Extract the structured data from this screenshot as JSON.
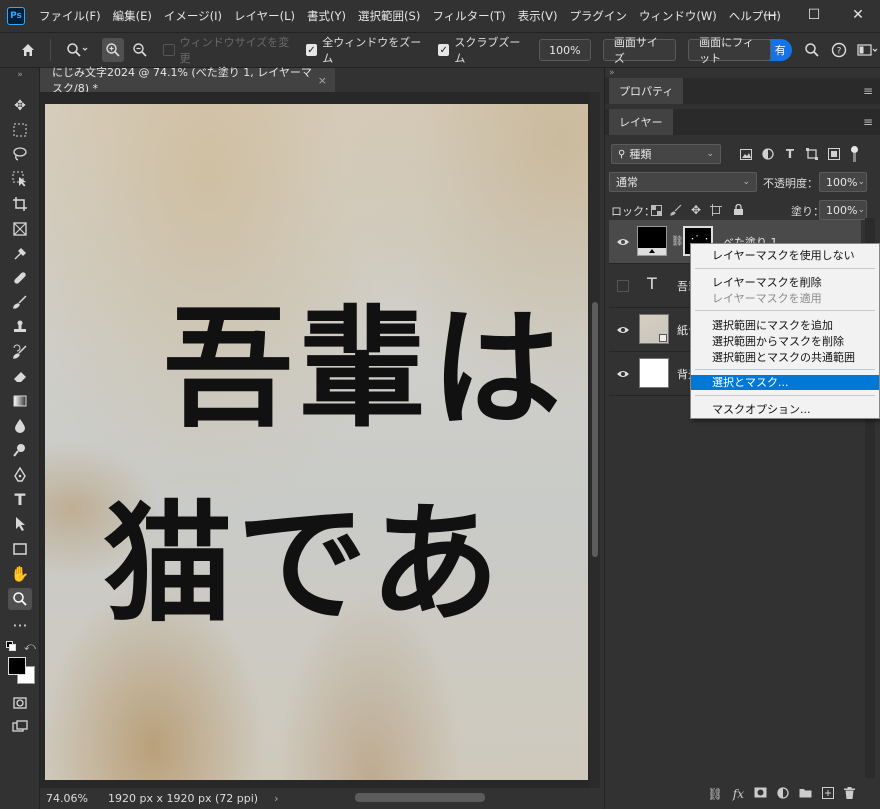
{
  "app": {
    "logo": "Ps",
    "menus": [
      "ファイル(F)",
      "編集(E)",
      "イメージ(I)",
      "レイヤー(L)",
      "書式(Y)",
      "選択範囲(S)",
      "フィルター(T)",
      "表示(V)",
      "プラグイン",
      "ウィンドウ(W)",
      "ヘルプ(H)"
    ],
    "window_controls": {
      "minimize": "—",
      "maximize": "☐",
      "close": "✕"
    }
  },
  "options_bar": {
    "home_icon": "home-icon",
    "zoom_icon": "zoom-tool-icon",
    "zoom_in_icon": "zoom-in-icon",
    "zoom_out_icon": "zoom-out-icon",
    "resize_windows": {
      "label": "ウィンドウサイズを変更",
      "checked": false,
      "enabled": false
    },
    "zoom_all_windows": {
      "label": "全ウィンドウをズーム",
      "checked": true
    },
    "scrubby_zoom": {
      "label": "スクラブズーム",
      "checked": true
    },
    "zoom_value": "100%",
    "fit_screen_label": "画面サイズ",
    "fill_screen_label": "画面にフィット",
    "share_label": "有",
    "share_color": "#1473e6"
  },
  "document": {
    "tab_title": "にじみ文字2024 @ 74.1% (べた塗り 1, レイヤーマスク/8) *",
    "tab_close": "×",
    "canvas_line1": "吾輩は",
    "canvas_line2": "猫であ",
    "zoom_readout": "74.06%",
    "dimensions": "1920 px x 1920 px (72 ppi)",
    "status_arrow": "›"
  },
  "panel": {
    "properties_tab": "プロパティ",
    "layers_tab": "レイヤー",
    "panel_menu_icon": "≡",
    "filter_kind": "種類",
    "blend_mode": "通常",
    "opacity_label": "不透明度：",
    "opacity_value": "100%",
    "lock_label": "ロック：",
    "fill_label": "塗り：",
    "fill_value": "100%",
    "layers": [
      {
        "name": "べた塗り 1",
        "visible": true,
        "selected": true,
        "type": "fill"
      },
      {
        "name": "吾輩",
        "visible": false,
        "selected": false,
        "type": "text"
      },
      {
        "name": "紙テ",
        "visible": true,
        "selected": false,
        "type": "image"
      },
      {
        "name": "背景",
        "visible": true,
        "selected": false,
        "type": "background"
      }
    ],
    "bottom_icons": [
      "link-icon",
      "fx-icon",
      "mask-icon",
      "adjustment-icon",
      "folder-icon",
      "new-layer-icon",
      "trash-icon"
    ]
  },
  "context_menu": {
    "items": [
      {
        "label": "レイヤーマスクを使用しない",
        "disabled": false,
        "highlighted": false
      },
      {
        "label": "レイヤーマスクを削除",
        "disabled": false,
        "highlighted": false
      },
      {
        "label": "レイヤーマスクを適用",
        "disabled": true,
        "highlighted": false
      },
      {
        "label": "選択範囲にマスクを追加",
        "disabled": false,
        "highlighted": false
      },
      {
        "label": "選択範囲からマスクを削除",
        "disabled": false,
        "highlighted": false
      },
      {
        "label": "選択範囲とマスクの共通範囲",
        "disabled": false,
        "highlighted": false
      },
      {
        "label": "選択とマスク...",
        "disabled": false,
        "highlighted": true
      },
      {
        "label": "マスクオプション...",
        "disabled": false,
        "highlighted": false
      }
    ],
    "highlight_color": "#0078d7"
  }
}
